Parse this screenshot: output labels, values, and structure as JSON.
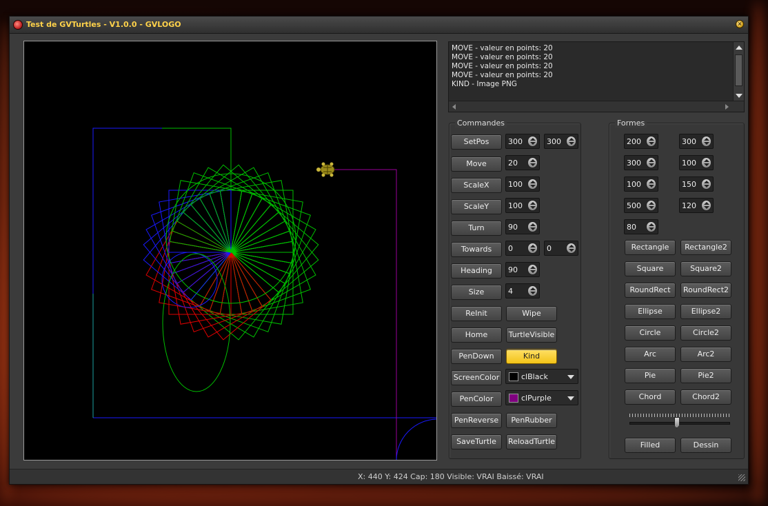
{
  "window": {
    "title": "Test de GVTurtles - V1.0.0 - GVLOGO",
    "close_glyph": "×"
  },
  "log": {
    "lines": [
      "MOVE - valeur en points: 20",
      "MOVE - valeur en points: 20",
      "MOVE - valeur en points: 20",
      "MOVE - valeur en points: 20",
      "KIND - Image PNG"
    ]
  },
  "commandes": {
    "title": "Commandes",
    "setpos": {
      "label": "SetPos",
      "x": "300",
      "y": "300"
    },
    "move": {
      "label": "Move",
      "value": "20"
    },
    "scalex": {
      "label": "ScaleX",
      "value": "100"
    },
    "scaley": {
      "label": "ScaleY",
      "value": "100"
    },
    "turn": {
      "label": "Turn",
      "value": "90"
    },
    "towards": {
      "label": "Towards",
      "x": "0",
      "y": "0"
    },
    "heading": {
      "label": "Heading",
      "value": "90"
    },
    "size": {
      "label": "Size",
      "value": "4"
    },
    "reinit": "ReInit",
    "wipe": "Wipe",
    "home": "Home",
    "turtlevisible": "TurtleVisible",
    "pendown": "PenDown",
    "kind": "Kind",
    "screencolor": {
      "label": "ScreenColor",
      "value": "clBlack",
      "color": "#000000"
    },
    "pencolor": {
      "label": "PenColor",
      "value": "clPurple",
      "color": "#800080"
    },
    "penreverse": "PenReverse",
    "penrubber": "PenRubber",
    "saveturtle": "SaveTurtle",
    "reloadturtle": "ReloadTurtle"
  },
  "formes": {
    "title": "Formes",
    "spins": [
      "200",
      "300",
      "300",
      "100",
      "100",
      "150",
      "500",
      "120",
      "80"
    ],
    "buttons": [
      "Rectangle",
      "Rectangle2",
      "Square",
      "Square2",
      "RoundRect",
      "RoundRect2",
      "Ellipse",
      "Ellipse2",
      "Circle",
      "Circle2",
      "Arc",
      "Arc2",
      "Pie",
      "Pie2",
      "Chord",
      "Chord2"
    ],
    "slider_fraction": 0.47,
    "filled": "Filled",
    "dessin": "Dessin"
  },
  "status": {
    "text": "X: 440 Y: 424 Cap: 180 Visible: VRAI Baissé: VRAI"
  },
  "colors": {
    "accent": "#ffd24a",
    "active_button": "#f2c318",
    "pen_green": "#00c000",
    "pen_red": "#e00000",
    "pen_blue": "#1a1aff",
    "pen_purple": "#9a009a"
  }
}
